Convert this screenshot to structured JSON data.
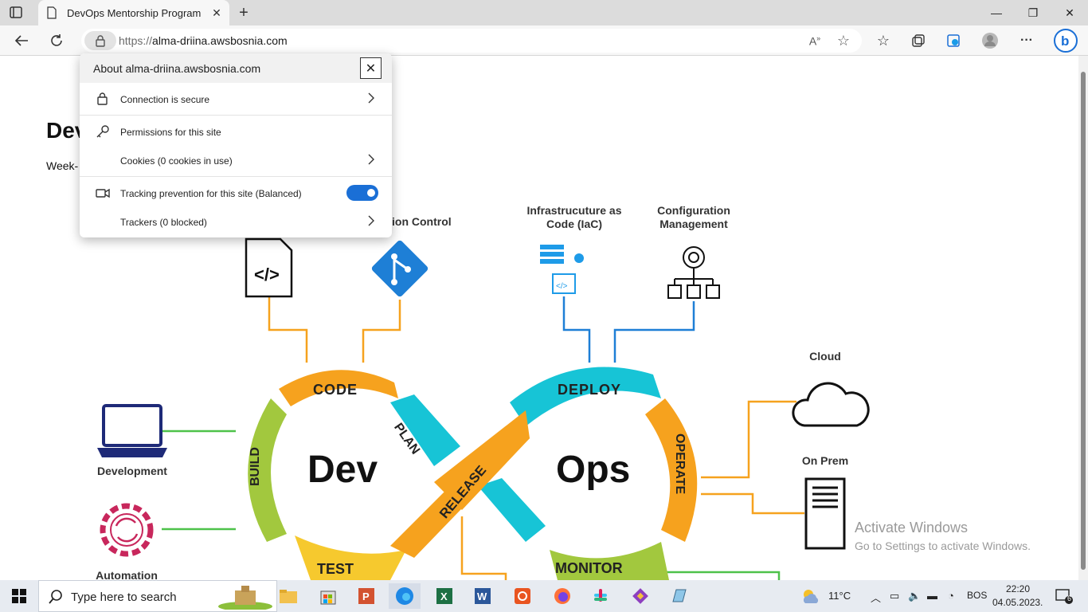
{
  "browser": {
    "tab_title": "DevOps Mentorship Program",
    "url_protocol": "https://",
    "url_host": "alma-driina.awsbosnia.com"
  },
  "popup": {
    "title": "About alma-driina.awsbosnia.com",
    "connection": "Connection is secure",
    "permissions": "Permissions for this site",
    "cookies": "Cookies (0 cookies in use)",
    "tracking": "Tracking prevention for this site (Balanced)",
    "trackers": "Trackers (0 blocked)",
    "tracking_enabled": true
  },
  "page": {
    "heading": "Dev",
    "subtext": "Week-"
  },
  "diagram": {
    "version_control": "ion Control",
    "iac": "Infrastrucuture as\nCode (IaC)",
    "config_mgmt": "Configuration\nManagement",
    "cloud": "Cloud",
    "on_prem": "On Prem",
    "development": "Development",
    "automation": "Automation",
    "dev": "Dev",
    "ops": "Ops",
    "code": "CODE",
    "plan": "PLAN",
    "build": "BUILD",
    "test": "TEST",
    "release": "RELEASE",
    "deploy": "DEPLOY",
    "operate": "OPERATE",
    "monitor": "MONITOR",
    "colors": {
      "orange": "#f6a21e",
      "green": "#a2c83e",
      "cyan": "#17c4d6",
      "yellow": "#f6c92e",
      "blue": "#1e7fd6",
      "lime": "#4ec24a"
    }
  },
  "watermark": {
    "line1": "Activate Windows",
    "line2": "Go to Settings to activate Windows."
  },
  "taskbar": {
    "search_placeholder": "Type here to search",
    "weather": "11°C",
    "language": "BOS",
    "time": "22:20",
    "date": "04.05.2023.",
    "notification_count": "6"
  }
}
